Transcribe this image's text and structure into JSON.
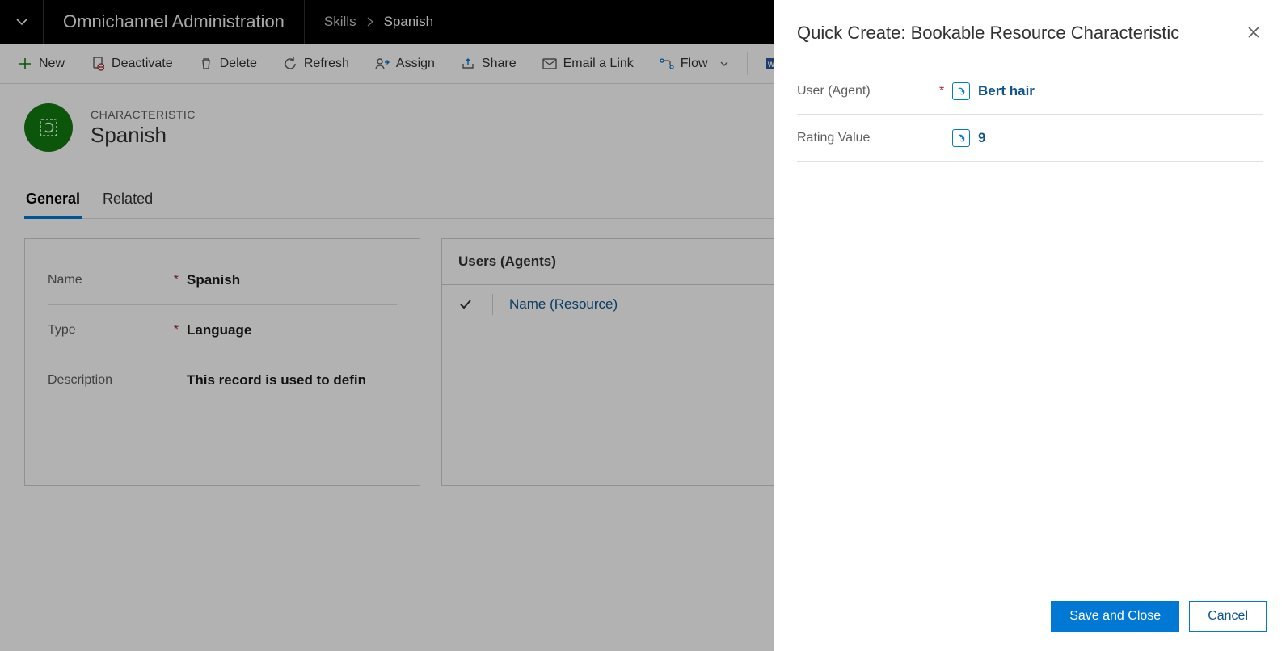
{
  "header": {
    "app_title": "Omnichannel Administration",
    "breadcrumb": {
      "root": "Skills",
      "current": "Spanish"
    }
  },
  "commands": {
    "new": "New",
    "deactivate": "Deactivate",
    "delete": "Delete",
    "refresh": "Refresh",
    "assign": "Assign",
    "share": "Share",
    "email_link": "Email a Link",
    "flow": "Flow"
  },
  "record": {
    "entity_label": "CHARACTERISTIC",
    "title": "Spanish"
  },
  "tabs": {
    "general": "General",
    "related": "Related"
  },
  "form": {
    "name_label": "Name",
    "name_value": "Spanish",
    "type_label": "Type",
    "type_value": "Language",
    "desc_label": "Description",
    "desc_value": "This record is used to defin"
  },
  "subgrid": {
    "title": "Users (Agents)",
    "col_name": "Name (Resource)"
  },
  "flyout": {
    "title": "Quick Create: Bookable Resource Characteristic",
    "user_label": "User (Agent)",
    "user_value": "Bert hair",
    "rating_label": "Rating Value",
    "rating_value": "9",
    "save": "Save and Close",
    "cancel": "Cancel"
  }
}
